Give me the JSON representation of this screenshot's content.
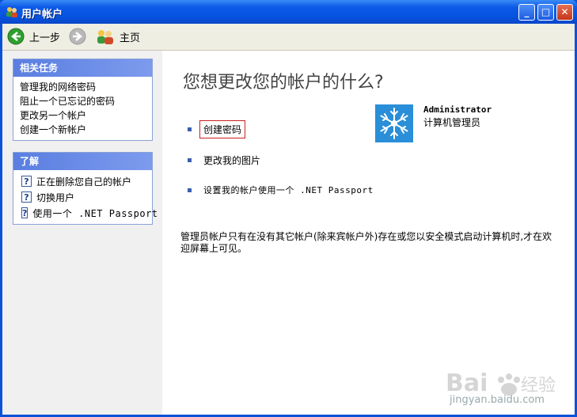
{
  "window": {
    "title": "用户帐户",
    "controls": {
      "minimize": "_",
      "maximize": "□",
      "close": "✕"
    }
  },
  "toolbar": {
    "back_label": "上一步",
    "home_label": "主页"
  },
  "related_tasks": {
    "header": "相关任务",
    "items": [
      {
        "label": "管理我的网络密码"
      },
      {
        "label": "阻止一个已忘记的密码"
      },
      {
        "label": "更改另一个帐户"
      },
      {
        "label": "创建一个新帐户"
      }
    ]
  },
  "learn_about": {
    "header": "了解",
    "items": [
      {
        "label": "正在删除您自己的帐户"
      },
      {
        "label": "切换用户"
      },
      {
        "label": "使用一个 .NET Passport"
      }
    ]
  },
  "main": {
    "heading": "您想更改您的帐户的什么?",
    "tasks": [
      {
        "label": "创建密码"
      },
      {
        "label": "更改我的图片"
      },
      {
        "label": "设置我的帐户使用一个 .NET Passport"
      }
    ],
    "user": {
      "name": "Administrator",
      "role": "计算机管理员"
    },
    "note": "管理员帐户只有在没有其它帐户(除来宾帐户外)存在或您以安全模式启动计算机时,才在欢迎屏幕上可见。"
  },
  "watermark": {
    "text": "jingyan.baidu.com"
  },
  "colors": {
    "title_bar": "#0c5ae8",
    "panel_header": "#5a7ee0",
    "highlight_border": "#cc2020"
  }
}
